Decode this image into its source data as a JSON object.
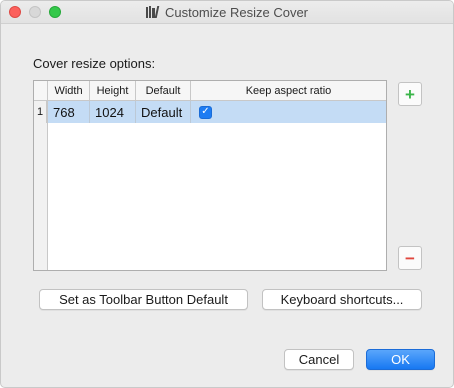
{
  "window": {
    "title": "Customize Resize Cover",
    "title_icon": "books-icon",
    "traffic_lights": [
      "close",
      "minimize",
      "zoom"
    ]
  },
  "section_label": "Cover resize options:",
  "table": {
    "columns": [
      "Width",
      "Height",
      "Default",
      "Keep aspect ratio"
    ],
    "rows": [
      {
        "index": "1",
        "width": "768",
        "height": "1024",
        "default": "Default",
        "keep_aspect_ratio": true
      }
    ],
    "checkmark": "✓"
  },
  "side_buttons": {
    "add": {
      "label": "+",
      "icon": "plus-icon",
      "color": "#3bb54a"
    },
    "remove": {
      "label": "−",
      "icon": "minus-icon",
      "color": "#e0473d"
    }
  },
  "buttons": {
    "toolbar_default": "Set as Toolbar Button Default",
    "shortcuts": "Keyboard shortcuts...",
    "cancel": "Cancel",
    "ok": "OK"
  },
  "colors": {
    "selection": "#c4dcf5",
    "accent": "#1778f2"
  }
}
